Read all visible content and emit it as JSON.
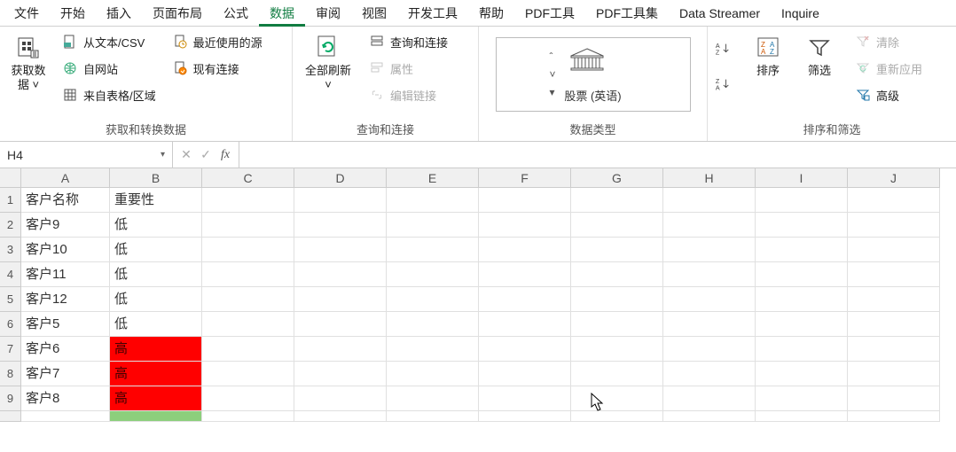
{
  "tabs": [
    "文件",
    "开始",
    "插入",
    "页面布局",
    "公式",
    "数据",
    "审阅",
    "视图",
    "开发工具",
    "帮助",
    "PDF工具",
    "PDF工具集",
    "Data Streamer",
    "Inquire"
  ],
  "active_tab_index": 5,
  "ribbon": {
    "group1": {
      "big": {
        "label_line1": "获取数",
        "label_line2": "据 ˅"
      },
      "items": [
        "从文本/CSV",
        "自网站",
        "来自表格/区域",
        "最近使用的源",
        "现有连接"
      ],
      "label": "获取和转换数据"
    },
    "group2": {
      "big": {
        "label_line1": "全部刷新",
        "caret": "˅"
      },
      "items": [
        "查询和连接",
        "属性",
        "编辑链接"
      ],
      "label": "查询和连接"
    },
    "group3": {
      "dt_label": "股票 (英语)",
      "label": "数据类型"
    },
    "group4": {
      "sort": "排序",
      "label": "排序和筛选",
      "filter": "筛选",
      "adv": [
        "清除",
        "重新应用",
        "高级"
      ]
    }
  },
  "namebox": "H4",
  "formula": "",
  "columns": [
    "A",
    "B",
    "C",
    "D",
    "E",
    "F",
    "G",
    "H",
    "I",
    "J"
  ],
  "rows": [
    {
      "n": "1",
      "a": "客户名称",
      "b": "重要性",
      "bcls": ""
    },
    {
      "n": "2",
      "a": "客户9",
      "b": "低",
      "bcls": ""
    },
    {
      "n": "3",
      "a": "客户10",
      "b": "低",
      "bcls": ""
    },
    {
      "n": "4",
      "a": "客户11",
      "b": "低",
      "bcls": ""
    },
    {
      "n": "5",
      "a": "客户12",
      "b": "低",
      "bcls": ""
    },
    {
      "n": "6",
      "a": "客户5",
      "b": "低",
      "bcls": ""
    },
    {
      "n": "7",
      "a": "客户6",
      "b": "高",
      "bcls": "hiB"
    },
    {
      "n": "8",
      "a": "客户7",
      "b": "高",
      "bcls": "hiB"
    },
    {
      "n": "9",
      "a": "客户8",
      "b": "高",
      "bcls": "hiB"
    }
  ]
}
